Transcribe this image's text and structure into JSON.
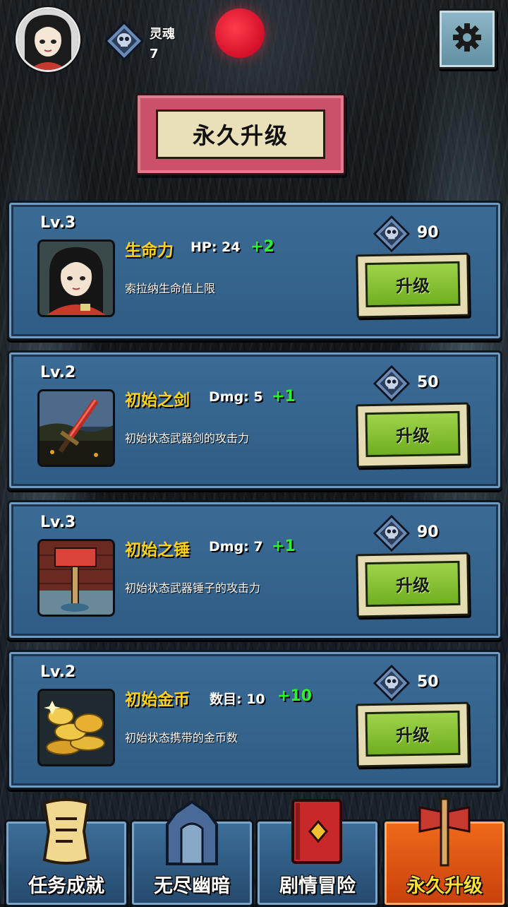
{
  "header": {
    "soul_label": "灵魂",
    "soul_value": "7",
    "title": "永久升级"
  },
  "upgrades": [
    {
      "level": "Lv.3",
      "name": "生命力",
      "stat": "HP: 24",
      "bonus": "+2",
      "description": "索拉纳生命值上限",
      "cost": "90",
      "button_label": "升级"
    },
    {
      "level": "Lv.2",
      "name": "初始之剑",
      "stat": "Dmg: 5",
      "bonus": "+1",
      "description": "初始状态武器剑的攻击力",
      "cost": "50",
      "button_label": "升级"
    },
    {
      "level": "Lv.3",
      "name": "初始之锤",
      "stat": "Dmg: 7",
      "bonus": "+1",
      "description": "初始状态武器锤子的攻击力",
      "cost": "90",
      "button_label": "升级"
    },
    {
      "level": "Lv.2",
      "name": "初始金币",
      "stat": "数目: 10",
      "bonus": "+10",
      "description": "初始状态携带的金币数",
      "cost": "50",
      "button_label": "升级"
    }
  ],
  "nav": {
    "items": [
      {
        "label": "任务成就",
        "icon": "scroll-icon",
        "active": false
      },
      {
        "label": "无尽幽暗",
        "icon": "tombstone-icon",
        "active": false
      },
      {
        "label": "剧情冒险",
        "icon": "book-icon",
        "active": false
      },
      {
        "label": "永久升级",
        "icon": "axe-icon",
        "active": true
      }
    ]
  },
  "colors": {
    "accent_yellow": "#ffd21a",
    "bonus_green": "#2ef02e",
    "card_blue": "#3b6c96",
    "button_green": "#8cc63f",
    "active_tab": "#f06a1a",
    "title_pink": "#c9526a"
  }
}
